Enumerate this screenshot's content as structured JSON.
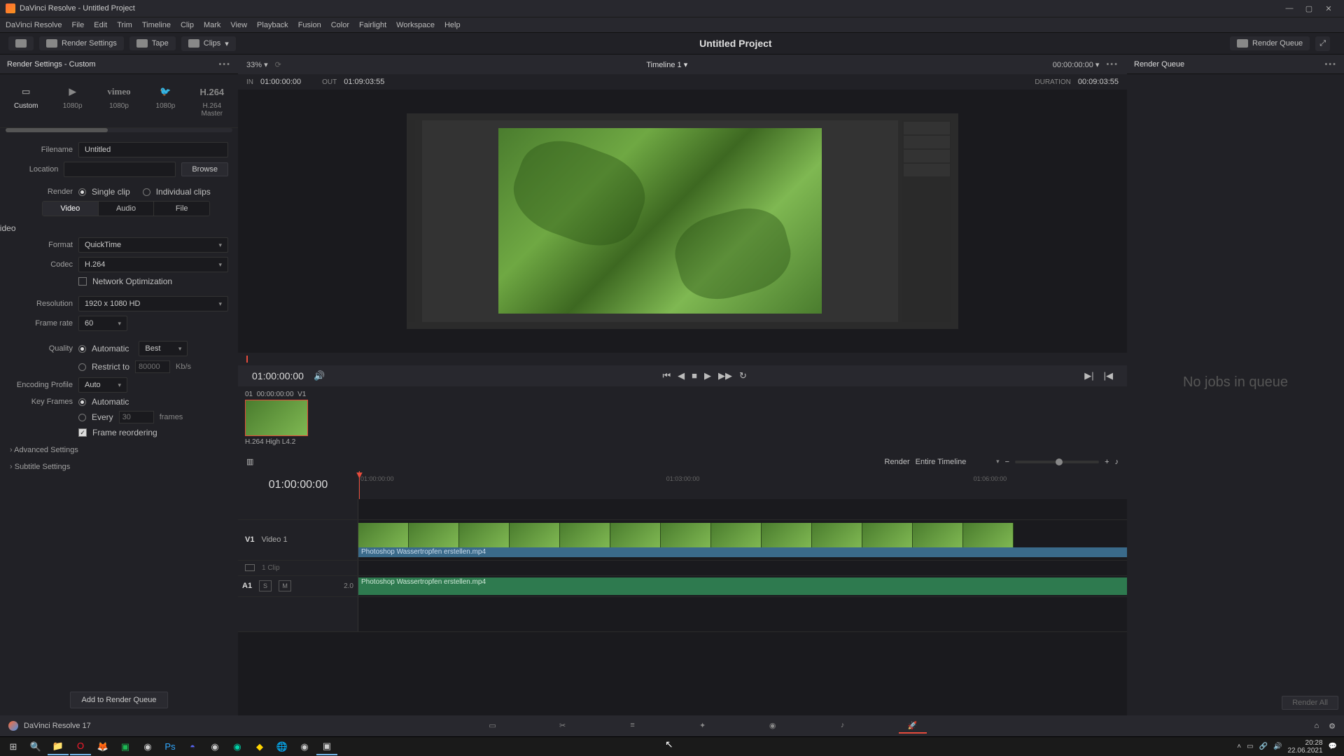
{
  "window": {
    "title": "DaVinci Resolve - Untitled Project"
  },
  "menu": [
    "DaVinci Resolve",
    "File",
    "Edit",
    "Trim",
    "Timeline",
    "Clip",
    "Mark",
    "View",
    "Playback",
    "Fusion",
    "Color",
    "Fairlight",
    "Workspace",
    "Help"
  ],
  "toolbar": {
    "render_settings": "Render Settings",
    "tape": "Tape",
    "clips": "Clips",
    "project_title": "Untitled Project",
    "render_queue": "Render Queue"
  },
  "left": {
    "title": "Render Settings - Custom",
    "presets": [
      {
        "name": "Custom",
        "icon": "▭"
      },
      {
        "name": "1080p",
        "icon": "▶YouTube"
      },
      {
        "name": "1080p",
        "icon": "vimeo"
      },
      {
        "name": "1080p",
        "icon": "🐦"
      },
      {
        "name": "H.264 Master",
        "icon": "H.264"
      }
    ],
    "filename_label": "Filename",
    "filename_value": "Untitled",
    "location_label": "Location",
    "location_value": "",
    "browse": "Browse",
    "render_label": "Render",
    "render_single": "Single clip",
    "render_individual": "Individual clips",
    "tabs": {
      "video": "Video",
      "audio": "Audio",
      "file": "File"
    },
    "export_video": "Export Video",
    "format_label": "Format",
    "format_value": "QuickTime",
    "codec_label": "Codec",
    "codec_value": "H.264",
    "network_opt": "Network Optimization",
    "resolution_label": "Resolution",
    "resolution_value": "1920 x 1080 HD",
    "framerate_label": "Frame rate",
    "framerate_value": "60",
    "quality_label": "Quality",
    "quality_auto": "Automatic",
    "quality_best": "Best",
    "restrict_to": "Restrict to",
    "restrict_value": "80000",
    "restrict_unit": "Kb/s",
    "encoding_profile_label": "Encoding Profile",
    "encoding_profile_value": "Auto",
    "keyframes_label": "Key Frames",
    "keyframes_auto": "Automatic",
    "keyframes_every": "Every",
    "keyframes_every_val": "30",
    "keyframes_every_unit": "frames",
    "frame_reorder": "Frame reordering",
    "advanced": "Advanced Settings",
    "subtitle": "Subtitle Settings",
    "add_queue": "Add to Render Queue"
  },
  "center": {
    "zoom": "33%",
    "timeline_name": "Timeline 1",
    "tc_display": "00:00:00:00",
    "in_label": "IN",
    "in_val": "01:00:00:00",
    "out_label": "OUT",
    "out_val": "01:09:03:55",
    "duration_label": "DURATION",
    "duration_val": "00:09:03:55",
    "transport_tc": "01:00:00:00",
    "clip_thumb": {
      "head_idx": "01",
      "head_tc": "00:00:00:00",
      "head_trk": "V1",
      "label": "H.264 High L4.2"
    }
  },
  "timeline": {
    "render_label": "Render",
    "render_scope": "Entire Timeline",
    "big_tc": "01:00:00:00",
    "ruler_ticks": [
      "01:00:00:00",
      "01:03:00:00",
      "01:06:00:00"
    ],
    "video_track": {
      "id": "V1",
      "name": "Video 1",
      "clips_info": "1 Clip"
    },
    "audio_track": {
      "id": "A1",
      "solo": "S",
      "mute": "M",
      "ch": "2.0"
    },
    "clip_name": "Photoshop Wassertropfen erstellen.mp4"
  },
  "right": {
    "title": "Render Queue",
    "empty": "No jobs in queue",
    "render_all": "Render All"
  },
  "footer": {
    "app_name": "DaVinci Resolve 17"
  },
  "taskbar": {
    "time": "20:28",
    "date": "22.06.2021"
  }
}
